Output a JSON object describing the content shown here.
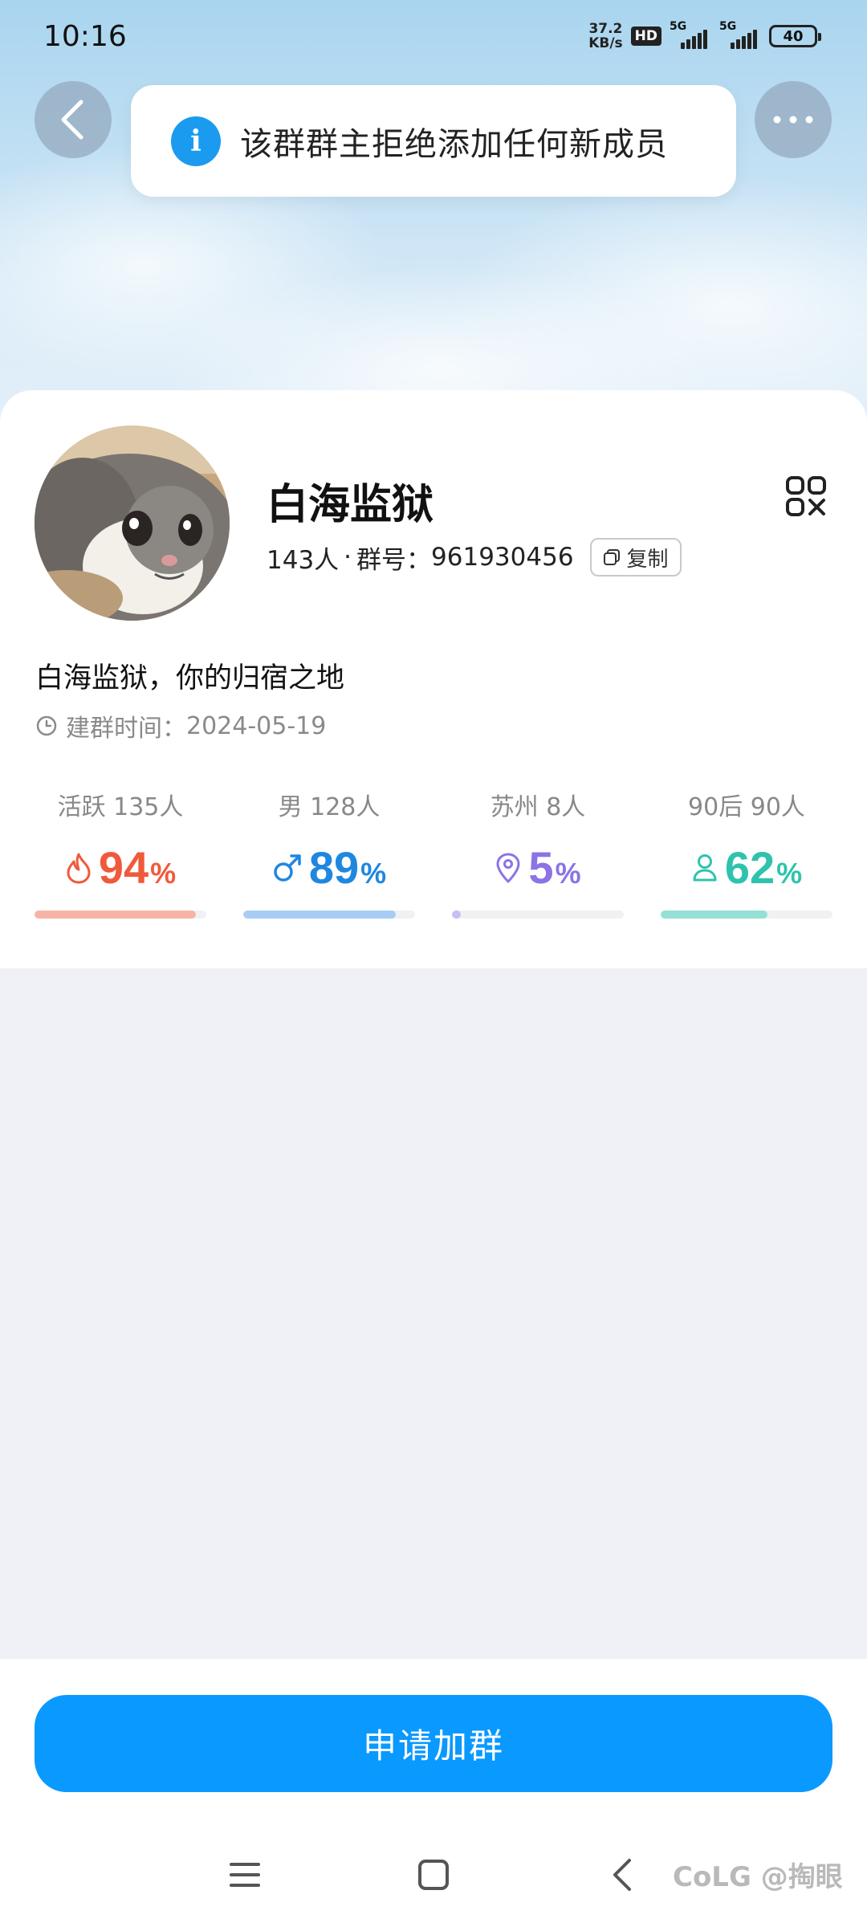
{
  "status_bar": {
    "time": "10:16",
    "net_speed_value": "37.2",
    "net_speed_unit": "KB/s",
    "hd_label": "HD",
    "signal1_label": "5G",
    "signal2_label": "5G",
    "battery": "40"
  },
  "toast": {
    "icon": "i",
    "message": "该群群主拒绝添加任何新成员"
  },
  "group": {
    "name": "白海监狱",
    "members": "143人",
    "id_label": "群号：",
    "id_value": "961930456",
    "copy_label": "复制",
    "description": "白海监狱，你的归宿之地",
    "created_label": "建群时间：",
    "created_date": "2024-05-19"
  },
  "stats": [
    {
      "label": "活跃 135人",
      "value": "94",
      "unit": "%",
      "color": "#f05a3c",
      "bar_color": "#f7b4a6",
      "fill": 0.94,
      "icon": "flame-icon"
    },
    {
      "label": "男 128人",
      "value": "89",
      "unit": "%",
      "color": "#1f87e0",
      "bar_color": "#a8cdf5",
      "fill": 0.89,
      "icon": "male-icon"
    },
    {
      "label": "苏州 8人",
      "value": "5",
      "unit": "%",
      "color": "#8c73e6",
      "bar_color": "#c9bdf2",
      "fill": 0.05,
      "icon": "location-pin-icon"
    },
    {
      "label": "90后 90人",
      "value": "62",
      "unit": "%",
      "color": "#2fc3ae",
      "bar_color": "#94e0d4",
      "fill": 0.62,
      "icon": "person-icon"
    }
  ],
  "actions": {
    "join_label": "申请加群"
  },
  "watermark": "CoLG @掏眼"
}
